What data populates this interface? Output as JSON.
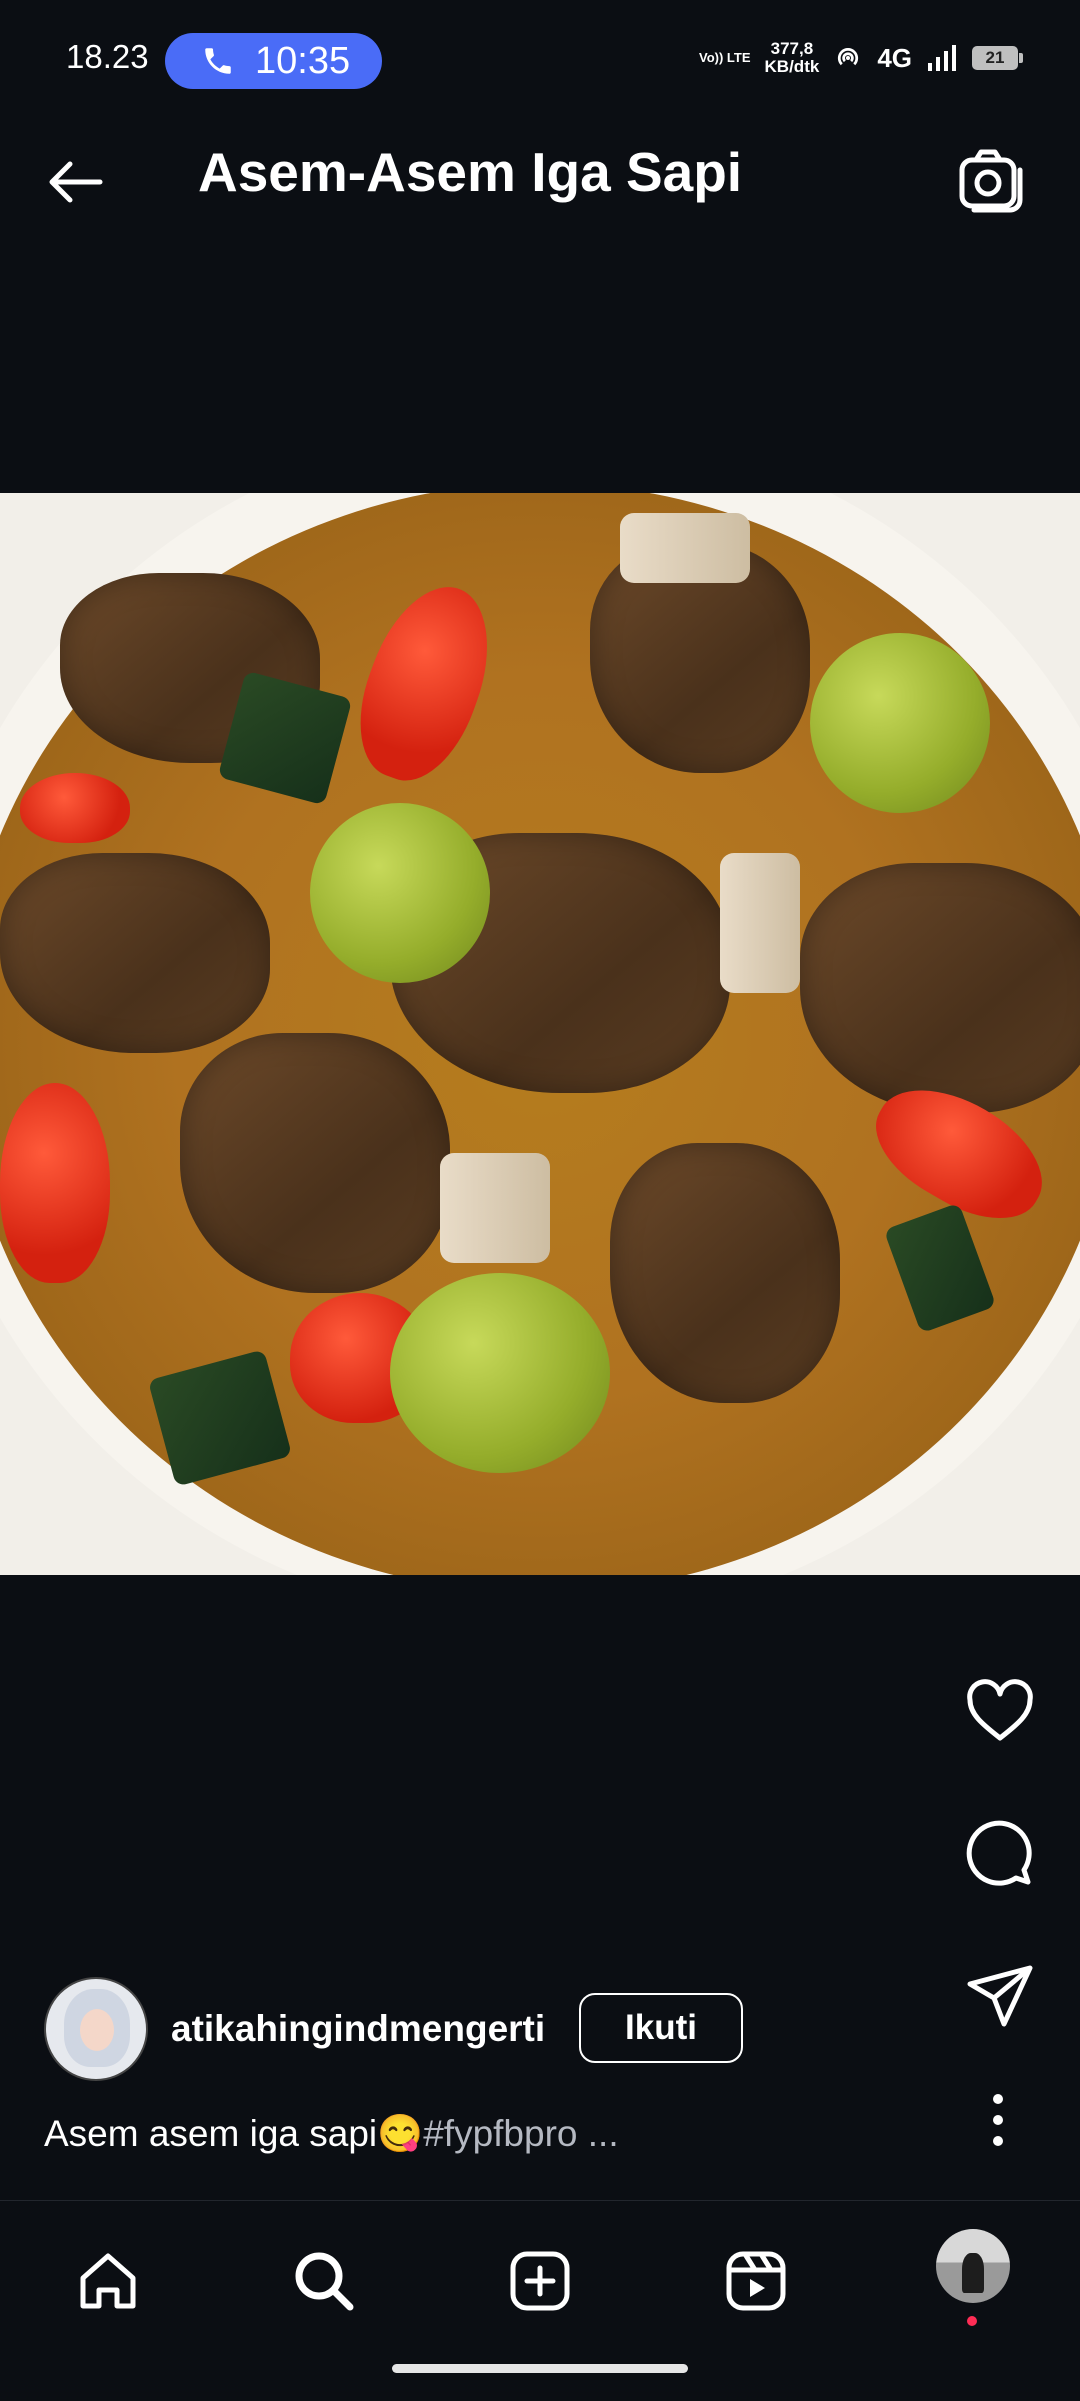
{
  "status_bar": {
    "time": "18.23",
    "call_timer": "10:35",
    "volte": "Vo)) LTE",
    "net_speed_value": "377,8",
    "net_speed_unit": "KB/dtk",
    "network_type": "4G",
    "battery": "21"
  },
  "header": {
    "title": "Asem-Asem Iga Sapi",
    "icons": {
      "back": "arrow-left-icon",
      "camera": "camera-icon"
    }
  },
  "actions": {
    "icons": [
      "heart-icon",
      "comment-icon",
      "send-icon",
      "more-vertical-icon"
    ]
  },
  "post": {
    "username": "atikahingindmengerti",
    "follow_label": "Ikuti",
    "caption_text": "Asem asem iga sapi😋",
    "caption_tags": "#fypfbpro ..."
  },
  "bottom_nav": {
    "items": [
      "home-icon",
      "search-icon",
      "create-icon",
      "reels-icon",
      "profile-avatar"
    ]
  },
  "colors": {
    "background": "#0b0e13",
    "call_pill": "#4a6cf7",
    "notification_dot": "#ff2d55",
    "hashtag": "#b5b9c2"
  }
}
